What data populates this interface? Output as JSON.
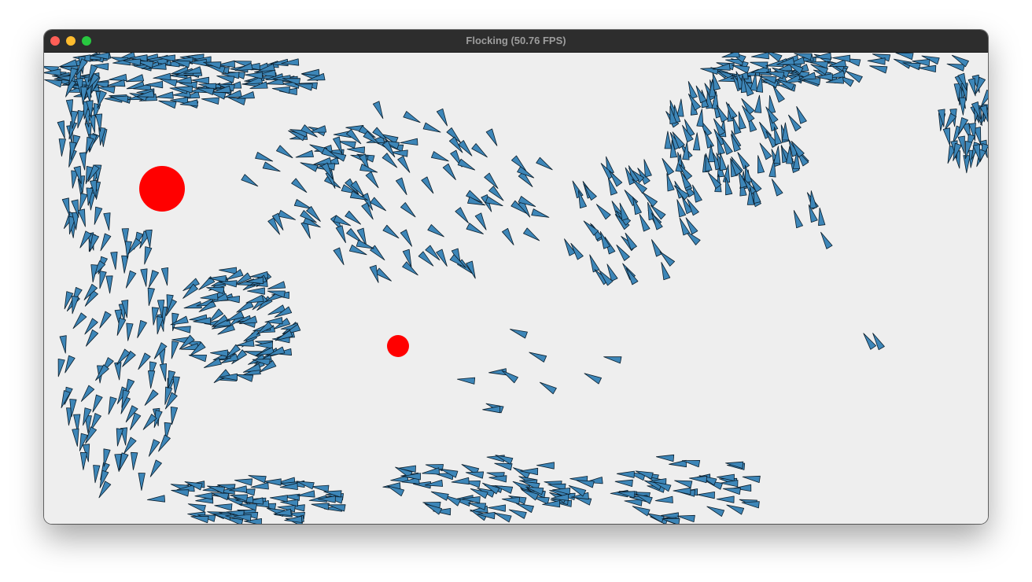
{
  "window": {
    "title": "Flocking (50.76 FPS)",
    "traffic_lights": [
      {
        "name": "close",
        "color": "#ff5f57"
      },
      {
        "name": "minimize",
        "color": "#febc2e"
      },
      {
        "name": "maximize",
        "color": "#28c840"
      }
    ]
  },
  "simulation": {
    "background_color": "#eeeeee",
    "boid_color": "#3d86b8",
    "boid_outline_color": "#0b1e2c",
    "obstacle_color": "#ff0000"
  }
}
